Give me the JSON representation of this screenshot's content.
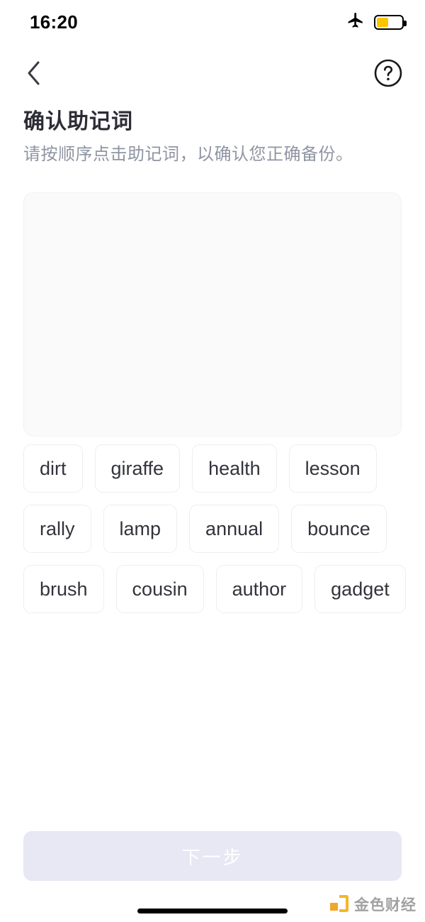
{
  "status_bar": {
    "time": "16:20",
    "airplane_icon": "airplane-mode-icon",
    "battery_icon": "battery-icon",
    "battery_level_pct": 48,
    "battery_color": "#ffc400"
  },
  "nav": {
    "back_icon": "chevron-left-icon",
    "help_icon": "question-circle-icon"
  },
  "header": {
    "title": "确认助记词",
    "subtitle": "请按顺序点击助记词，以确认您正确备份。"
  },
  "answer_area": {
    "selected_words": [],
    "placeholder": ""
  },
  "word_bank": {
    "words": [
      "dirt",
      "giraffe",
      "health",
      "lesson",
      "rally",
      "lamp",
      "annual",
      "bounce",
      "brush",
      "cousin",
      "author",
      "gadget"
    ]
  },
  "footer": {
    "next_label": "下一步",
    "next_enabled": false,
    "next_bg_color": "#e8e7f4"
  },
  "watermark": {
    "text": "金色财经",
    "mark_color": "#f5b018"
  }
}
